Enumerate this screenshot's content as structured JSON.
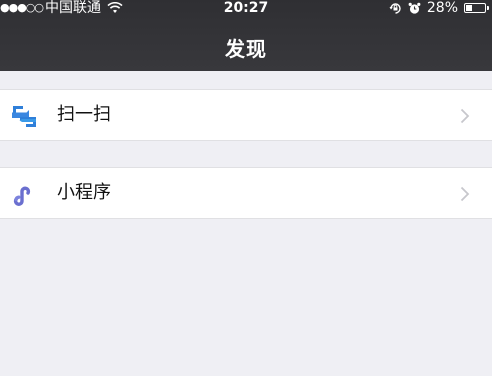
{
  "status_bar": {
    "signal": "●●●○○",
    "carrier": "中国联通",
    "time": "20:27",
    "battery_text": "28%",
    "battery_level": 0.28,
    "icons": [
      "wifi-icon",
      "rotation-lock-icon",
      "alarm-icon",
      "battery-icon"
    ]
  },
  "nav": {
    "title": "发现"
  },
  "menu": {
    "items": [
      {
        "label": "扫一扫",
        "icon": "scan-icon",
        "icon_color": "#3a87e0"
      },
      {
        "label": "小程序",
        "icon": "mini-program-icon",
        "icon_color": "#6a6fcf"
      }
    ]
  },
  "colors": {
    "nav_bg": "#333337",
    "page_bg": "#efeff4",
    "cell_bg": "#ffffff",
    "chevron": "#c7c7cc"
  }
}
